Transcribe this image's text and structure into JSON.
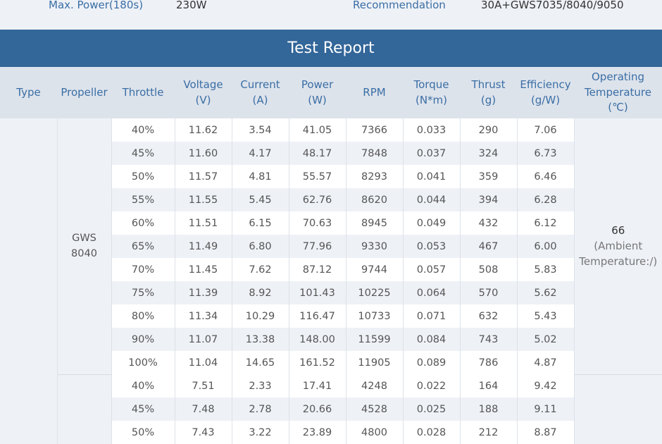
{
  "specs": [
    {
      "label": "Max. Power(180s)",
      "value": "230W"
    },
    {
      "label": "Recommendation",
      "value": "30A+GWS7035/8040/9050"
    }
  ],
  "report_title": "Test Report",
  "columns": [
    [
      "Type"
    ],
    [
      "Propeller"
    ],
    [
      "Throttle"
    ],
    [
      "Voltage",
      "(V)"
    ],
    [
      "Current",
      "(A)"
    ],
    [
      "Power",
      "(W)"
    ],
    [
      "RPM"
    ],
    [
      "Torque",
      "(N*m)"
    ],
    [
      "Thrust",
      "(g)"
    ],
    [
      "Efficiency",
      "(g/W)"
    ],
    [
      "Operating",
      "Temperature",
      "(℃)"
    ]
  ],
  "groups": [
    {
      "propeller": [
        "GWS",
        "8040"
      ],
      "temperature": {
        "value": "66",
        "note": [
          "(Ambient",
          "Temperature:/)"
        ]
      },
      "rows": [
        [
          "40%",
          "11.62",
          "3.54",
          "41.05",
          "7366",
          "0.033",
          "290",
          "7.06"
        ],
        [
          "45%",
          "11.60",
          "4.17",
          "48.17",
          "7848",
          "0.037",
          "324",
          "6.73"
        ],
        [
          "50%",
          "11.57",
          "4.81",
          "55.57",
          "8293",
          "0.041",
          "359",
          "6.46"
        ],
        [
          "55%",
          "11.55",
          "5.45",
          "62.76",
          "8620",
          "0.044",
          "394",
          "6.28"
        ],
        [
          "60%",
          "11.51",
          "6.15",
          "70.63",
          "8945",
          "0.049",
          "432",
          "6.12"
        ],
        [
          "65%",
          "11.49",
          "6.80",
          "77.96",
          "9330",
          "0.053",
          "467",
          "6.00"
        ],
        [
          "70%",
          "11.45",
          "7.62",
          "87.12",
          "9744",
          "0.057",
          "508",
          "5.83"
        ],
        [
          "75%",
          "11.39",
          "8.92",
          "101.43",
          "10225",
          "0.064",
          "570",
          "5.62"
        ],
        [
          "80%",
          "11.34",
          "10.29",
          "116.47",
          "10733",
          "0.071",
          "632",
          "5.43"
        ],
        [
          "90%",
          "11.07",
          "13.38",
          "148.00",
          "11599",
          "0.084",
          "743",
          "5.02"
        ],
        [
          "100%",
          "11.04",
          "14.65",
          "161.52",
          "11905",
          "0.089",
          "786",
          "4.87"
        ]
      ]
    },
    {
      "propeller": [],
      "temperature": {
        "value": "",
        "note": []
      },
      "rows": [
        [
          "40%",
          "7.51",
          "2.33",
          "17.41",
          "4248",
          "0.022",
          "164",
          "9.42"
        ],
        [
          "45%",
          "7.48",
          "2.78",
          "20.66",
          "4528",
          "0.025",
          "188",
          "9.11"
        ],
        [
          "50%",
          "7.43",
          "3.22",
          "23.89",
          "4800",
          "0.028",
          "212",
          "8.87"
        ]
      ]
    }
  ]
}
